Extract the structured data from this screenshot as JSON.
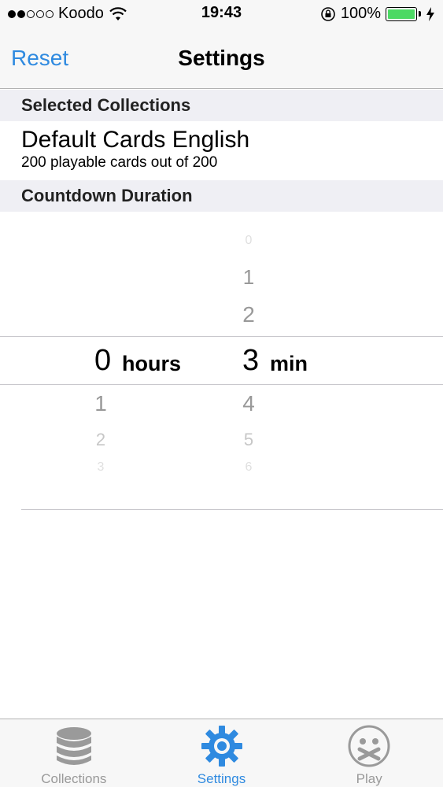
{
  "status_bar": {
    "carrier": "Koodo",
    "time": "19:43",
    "battery_percent": "100%",
    "battery_level": 1.0,
    "battery_color": "#4cd964"
  },
  "nav": {
    "left_button": "Reset",
    "title": "Settings",
    "accent_color": "#2f8ae0"
  },
  "sections": {
    "collections_header": "Selected Collections",
    "collection_name": "Default Cards English",
    "collection_detail": "200 playable cards out of 200",
    "countdown_header": "Countdown Duration"
  },
  "picker": {
    "hours_selected": "0",
    "hours_unit": "hours",
    "minutes_selected": "3",
    "minutes_unit": "min",
    "hours_below": [
      "1",
      "2",
      "3"
    ],
    "minutes_above": [
      "0",
      "1",
      "2"
    ],
    "minutes_below": [
      "4",
      "5",
      "6"
    ]
  },
  "tabs": [
    {
      "label": "Collections",
      "icon": "database-icon",
      "active": false
    },
    {
      "label": "Settings",
      "icon": "gear-icon",
      "active": true
    },
    {
      "label": "Play",
      "icon": "muted-face-icon",
      "active": false
    }
  ]
}
